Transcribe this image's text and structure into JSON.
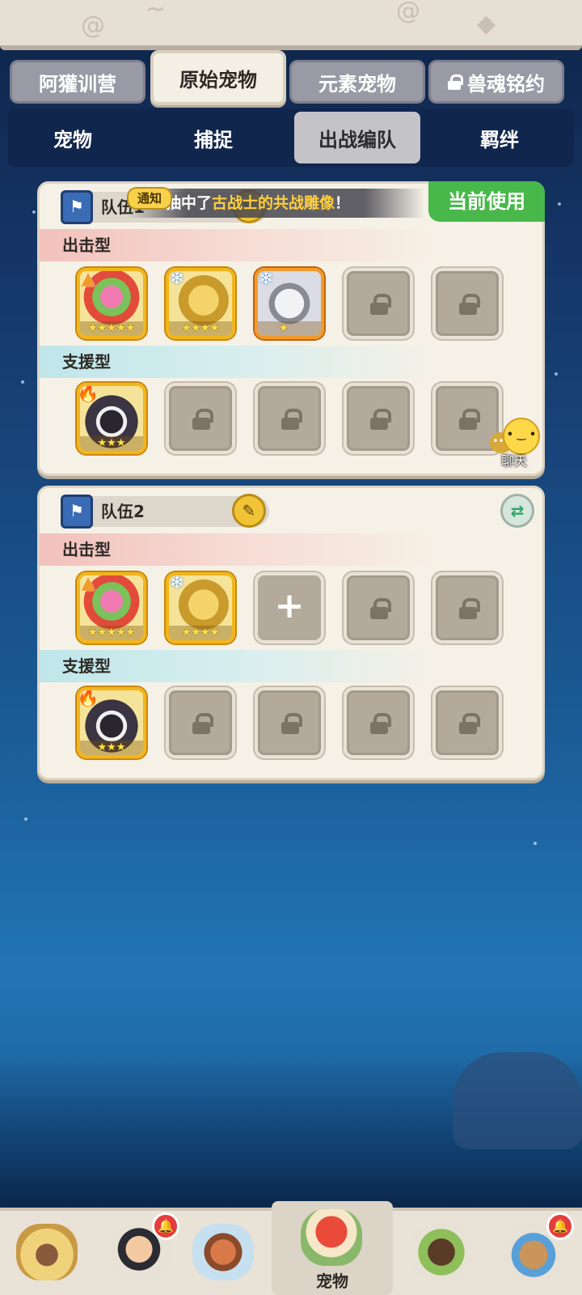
{
  "top_tabs": [
    {
      "label": "阿獾训营",
      "locked": false,
      "active": false
    },
    {
      "label": "原始宠物",
      "locked": false,
      "active": true
    },
    {
      "label": "元素宠物",
      "locked": false,
      "active": false
    },
    {
      "label": "兽魂铭约",
      "locked": true,
      "active": false
    }
  ],
  "sub_tabs": [
    {
      "label": "宠物",
      "active": false
    },
    {
      "label": "捕捉",
      "active": false
    },
    {
      "label": "出战编队",
      "active": true
    },
    {
      "label": "羁绊",
      "active": false
    }
  ],
  "notice": {
    "tag": "通知",
    "prefix": "抽中了",
    "highlight": "古战士的共战雕像",
    "suffix": "！"
  },
  "teams": [
    {
      "name": "队伍1",
      "current_label": "当前使用",
      "attack_label": "出击型",
      "support_label": "支援型",
      "attack_slots": [
        {
          "state": "pet",
          "pet": "plant-monster",
          "element": "triangle",
          "stars": 5
        },
        {
          "state": "pet",
          "pet": "lion",
          "element": "ice",
          "stars": 4
        },
        {
          "state": "pet",
          "pet": "white-wolf",
          "element": "ice",
          "stars": 1,
          "orange": true
        },
        {
          "state": "locked"
        },
        {
          "state": "locked"
        }
      ],
      "support_slots": [
        {
          "state": "pet",
          "pet": "boar",
          "element": "fire",
          "stars": 3
        },
        {
          "state": "locked"
        },
        {
          "state": "locked"
        },
        {
          "state": "locked"
        },
        {
          "state": "locked"
        }
      ]
    },
    {
      "name": "队伍2",
      "attack_label": "出击型",
      "support_label": "支援型",
      "attack_slots": [
        {
          "state": "pet",
          "pet": "plant-monster",
          "element": "triangle",
          "stars": 5
        },
        {
          "state": "pet",
          "pet": "lion",
          "element": "ice",
          "stars": 4
        },
        {
          "state": "add"
        },
        {
          "state": "locked"
        },
        {
          "state": "locked"
        }
      ],
      "support_slots": [
        {
          "state": "pet",
          "pet": "boar",
          "element": "fire",
          "stars": 3
        },
        {
          "state": "locked"
        },
        {
          "state": "locked"
        },
        {
          "state": "locked"
        },
        {
          "state": "locked"
        }
      ]
    }
  ],
  "chat": {
    "label": "聊天"
  },
  "bottom_nav": [
    {
      "name": "caveman-nav",
      "label": "",
      "badge": false
    },
    {
      "name": "hero-nav",
      "label": "",
      "badge": true
    },
    {
      "name": "tiki-nav",
      "label": "",
      "badge": false
    },
    {
      "name": "pet-nav",
      "label": "宠物",
      "badge": false,
      "active": true
    },
    {
      "name": "bear-nav",
      "label": "",
      "badge": false
    },
    {
      "name": "hut-nav",
      "label": "",
      "badge": true
    }
  ],
  "colors": {
    "accent_green": "#49b84a",
    "gold": "#f2b51c",
    "highlight_text": "#ffcf3d"
  }
}
